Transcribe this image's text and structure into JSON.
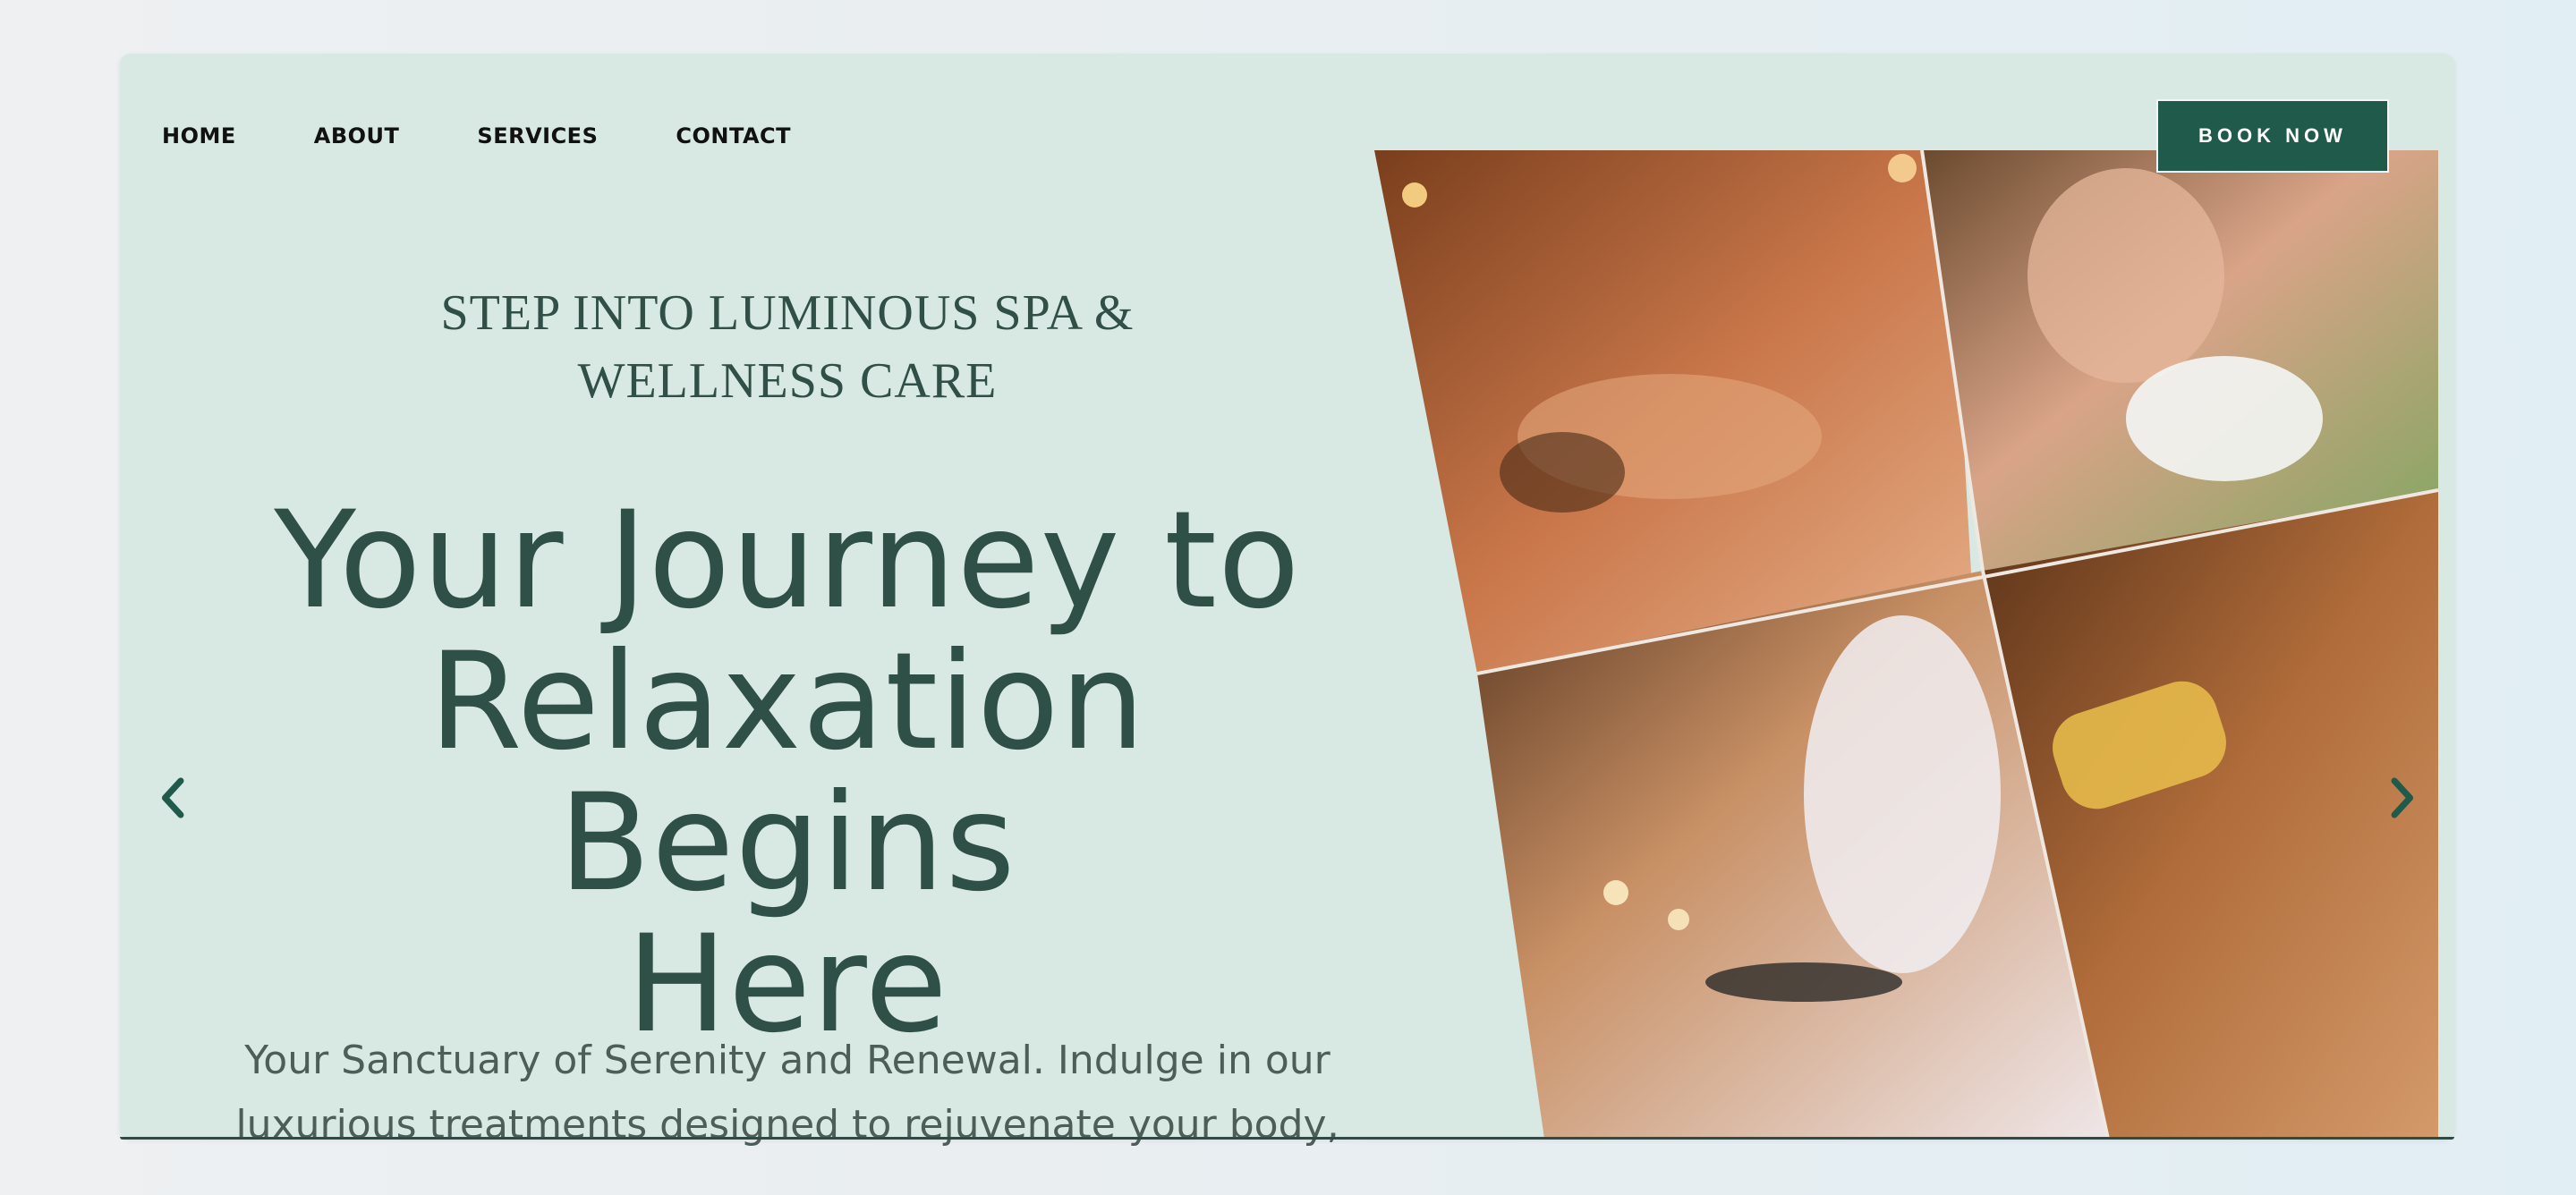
{
  "nav": {
    "items": [
      {
        "label": "HOME"
      },
      {
        "label": "ABOUT"
      },
      {
        "label": "SERVICES"
      },
      {
        "label": "CONTACT"
      }
    ]
  },
  "cta": {
    "label": "BOOK NOW"
  },
  "hero": {
    "eyebrow_line1": "STEP INTO LUMINOUS SPA &",
    "eyebrow_line2": "WELLNESS CARE",
    "headline_line1": "Your Journey to",
    "headline_line2": "Relaxation Begins",
    "headline_line3": "Here",
    "subtext_line1": "Your Sanctuary of Serenity and Renewal. Indulge in our",
    "subtext_line2": "luxurious treatments designed to rejuvenate your body,"
  },
  "icons": {
    "prev": "chevron-left-icon",
    "next": "chevron-right-icon"
  },
  "colors": {
    "background": "#d8e8e3",
    "accent": "#1f5a4b",
    "heading": "#2e5046",
    "body_text": "#4d5e59"
  }
}
